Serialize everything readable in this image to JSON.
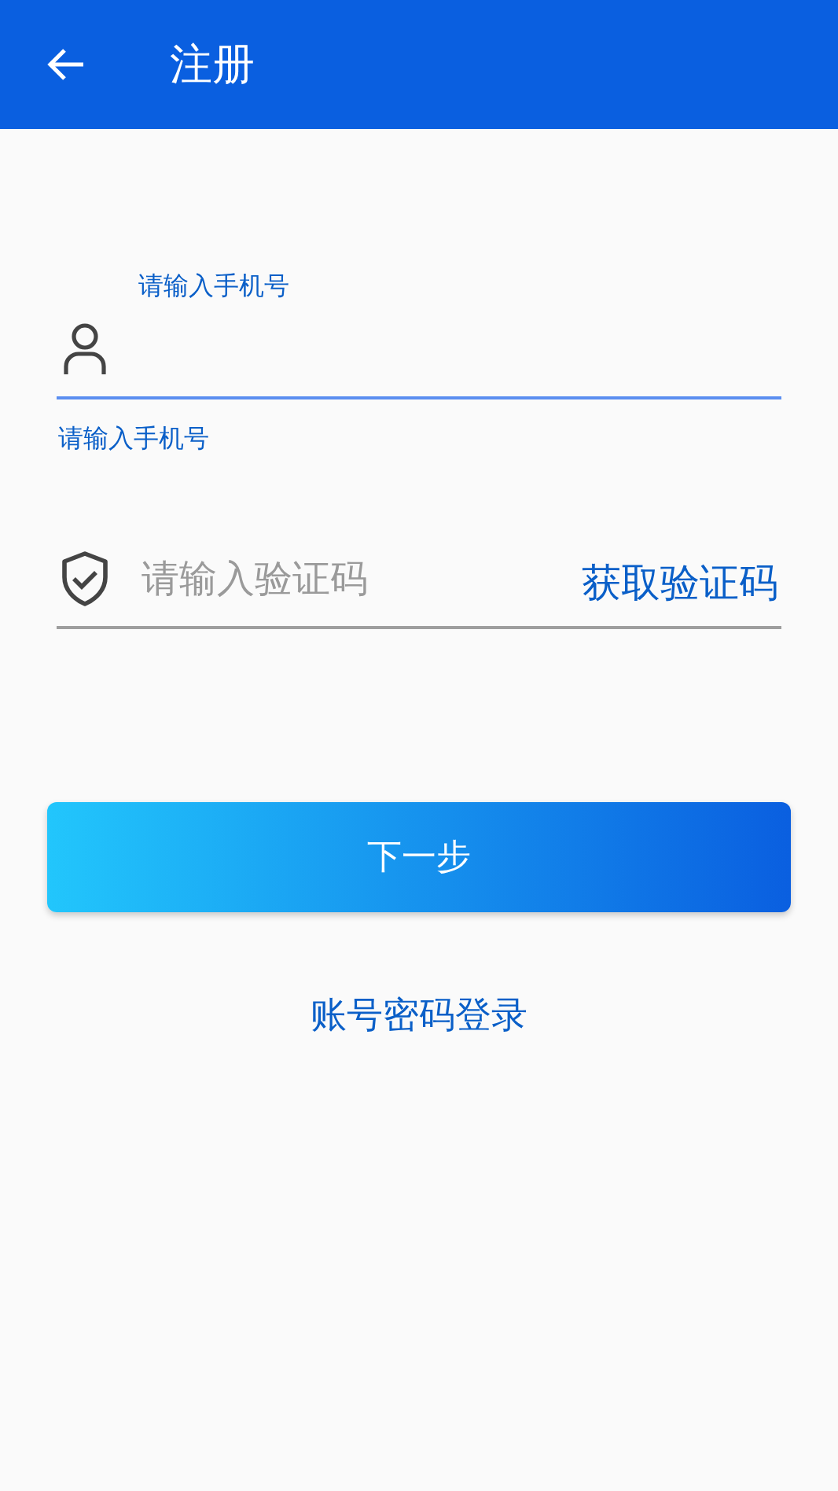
{
  "app_bar": {
    "title": "注册"
  },
  "phone_field": {
    "label": "请输入手机号",
    "focused": true,
    "helper": "请输入手机号"
  },
  "code_field": {
    "placeholder": "请输入验证码",
    "focused": false,
    "action": "获取验证码"
  },
  "next_button": {
    "label": "下一步"
  },
  "alt_login_link": {
    "label": "账号密码登录"
  }
}
